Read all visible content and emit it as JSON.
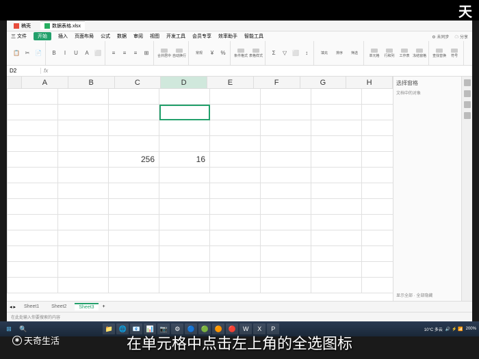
{
  "watermark": "天",
  "tabs": [
    {
      "icon": "red",
      "label": "稿壳"
    },
    {
      "icon": "green",
      "label": "数据表格.xlsx"
    }
  ],
  "menu": {
    "items": [
      "三 文件",
      "开始",
      "插入",
      "页面布局",
      "公式",
      "数据",
      "审阅",
      "视图",
      "开发工具",
      "会员专享",
      "效率助手",
      "智能工具"
    ],
    "active_index": 1,
    "right": [
      "⚙ 未同步",
      "☁ 分享"
    ]
  },
  "toolbar": {
    "groups": [
      {
        "buttons": [
          "📋",
          "✂",
          "📄"
        ]
      },
      {
        "buttons": [
          "B",
          "I",
          "U",
          "A",
          "⬜"
        ]
      },
      {
        "buttons": [
          "≡",
          "≡",
          "≡",
          "⊞"
        ]
      },
      {
        "labels": [
          "合并居中",
          "自动换行"
        ]
      },
      {
        "labels": [
          "常规",
          "¥",
          "%"
        ]
      },
      {
        "labels": [
          "条件格式",
          "表格样式"
        ]
      },
      {
        "buttons": [
          "Σ",
          "▽",
          "⬜",
          "↕"
        ]
      },
      {
        "labels": [
          "填充",
          "排序",
          "筛选"
        ]
      },
      {
        "labels": [
          "单元格",
          "行和列",
          "工作表",
          "冻结窗格"
        ]
      },
      {
        "labels": [
          "查找替换",
          "符号"
        ]
      }
    ]
  },
  "formula": {
    "name_box": "D2",
    "fx": "fx"
  },
  "grid": {
    "columns": [
      "A",
      "B",
      "C",
      "D",
      "E",
      "F",
      "G",
      "H"
    ],
    "selected_col": "D",
    "active_cell": {
      "r": 2,
      "c": 3
    },
    "data": {
      "C5": "256",
      "D5": "16"
    }
  },
  "side_panel": {
    "title": "选择窗格",
    "subtitle": "文档中的对象",
    "bottom": "显示全部 · 全部隐藏"
  },
  "sheets": {
    "items": [
      "Sheet1",
      "Sheet2",
      "Sheet3"
    ],
    "active": 2,
    "add": "+"
  },
  "status_bar": {
    "text": "在此处输入你要搜索的内容"
  },
  "taskbar": {
    "start": "⊞",
    "search": "🔍",
    "apps": [
      "📁",
      "🌐",
      "📧",
      "📊",
      "📷",
      "⚙",
      "🔵",
      "🟢",
      "🟠",
      "🔴",
      "W",
      "X",
      "P"
    ],
    "sys": {
      "weather": "10°C 多云",
      "icons": "🔊 ⚡ 📶",
      "zoom": "200%"
    }
  },
  "caption": "在单元格中点击左上角的全选图标",
  "logo": "天奇生活"
}
